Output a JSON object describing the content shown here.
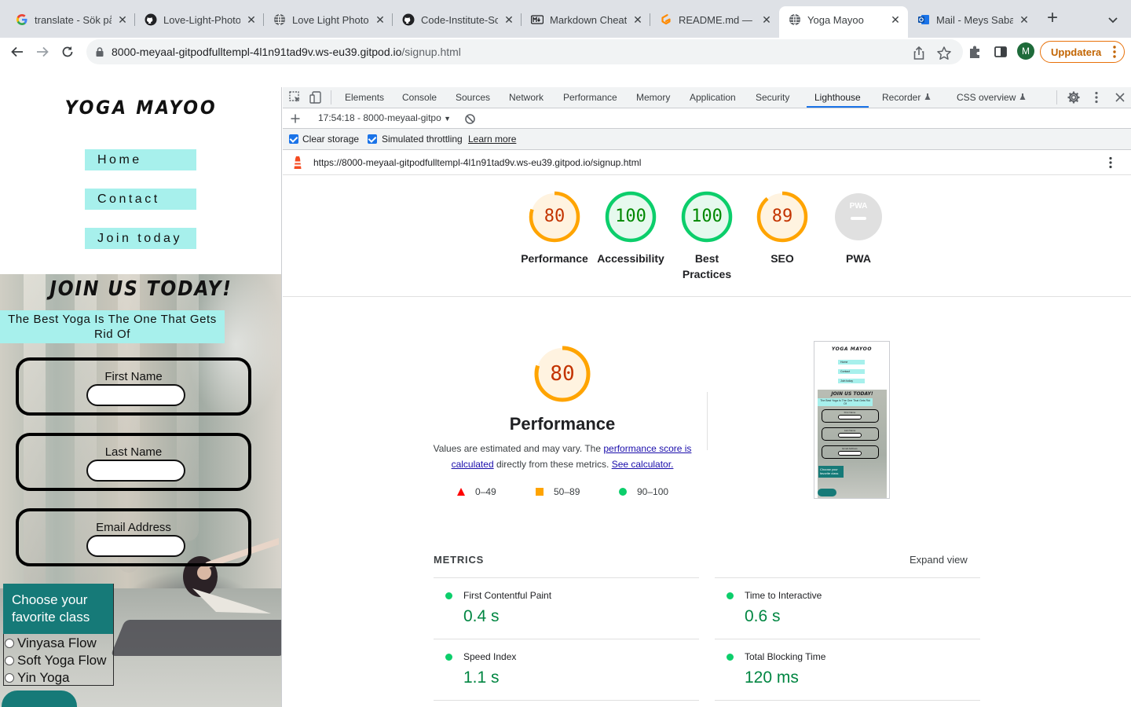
{
  "browser": {
    "tabs": [
      {
        "title": "translate - Sök på",
        "icon": "google-icon"
      },
      {
        "title": "Love-Light-Photo",
        "icon": "github-icon"
      },
      {
        "title": "Love Light Photog",
        "icon": "globe-icon"
      },
      {
        "title": "Code-Institute-So",
        "icon": "github-icon"
      },
      {
        "title": "Markdown Cheat",
        "icon": "markdown-icon"
      },
      {
        "title": "README.md — gi",
        "icon": "gitpod-icon"
      },
      {
        "title": "Yoga Mayoo",
        "icon": "globe-icon",
        "active": true
      },
      {
        "title": "Mail - Meys Saba",
        "icon": "outlook-icon"
      }
    ],
    "url_host": "8000-meyaal-gitpodfulltempl-4l1n91tad9v.ws-eu39.gitpod.io",
    "url_path": "/signup.html",
    "avatar_letter": "M",
    "update_label": "Uppdatera"
  },
  "site": {
    "logo": "YOGA MAYOO",
    "nav": [
      "Home",
      "Contact",
      "Join today"
    ],
    "join_title": "JOIN US TODAY!",
    "tagline": "The Best Yoga Is The One That Gets Rid Of",
    "fields": [
      "First Name",
      "Last Name",
      "Email Address"
    ],
    "class_heading": "Choose your favorite class",
    "classes": [
      "Vinyasa Flow",
      "Soft Yoga Flow",
      "Yin Yoga"
    ]
  },
  "devtools": {
    "tabs": [
      "Elements",
      "Console",
      "Sources",
      "Network",
      "Performance",
      "Memory",
      "Application",
      "Security",
      "Lighthouse",
      "Recorder",
      "CSS overview"
    ],
    "active_tab": "Lighthouse",
    "report_select": "17:54:18 - 8000-meyaal-gitpo",
    "clear_storage": "Clear storage",
    "simulated_throttling": "Simulated throttling",
    "learn_more": "Learn more",
    "report_url": "https://8000-meyaal-gitpodfulltempl-4l1n91tad9v.ws-eu39.gitpod.io/signup.html"
  },
  "lighthouse": {
    "scores": [
      {
        "label": "Performance",
        "value": "80",
        "score": 0.8,
        "color": "#c33300",
        "ring": "#ffa400",
        "fill": "#fff3e0"
      },
      {
        "label": "Accessibility",
        "value": "100",
        "score": 1.0,
        "color": "#008800",
        "ring": "#0cce6b",
        "fill": "#e6f9ee"
      },
      {
        "label": "Best Practices",
        "value": "100",
        "score": 1.0,
        "color": "#008800",
        "ring": "#0cce6b",
        "fill": "#e6f9ee"
      },
      {
        "label": "SEO",
        "value": "89",
        "score": 0.89,
        "color": "#c33300",
        "ring": "#ffa400",
        "fill": "#fff3e0"
      },
      {
        "label": "PWA",
        "value": "",
        "score": 0,
        "color": "#9aa0a6",
        "ring": "#e0e0e0",
        "fill": "#e0e0e0"
      }
    ],
    "pwa_badge": "PWA",
    "main_score": "80",
    "main_score_fraction": 0.8,
    "main_title": "Performance",
    "desc_prefix": "Values are estimated and may vary. The",
    "desc_link1": "performance score is calculated",
    "desc_middle": "directly from these metrics.",
    "desc_link2": "See calculator.",
    "legend": [
      "0–49",
      "50–89",
      "90–100"
    ],
    "metrics_heading": "METRICS",
    "expand_label": "Expand view",
    "metrics": [
      {
        "name": "First Contentful Paint",
        "value": "0.4 s"
      },
      {
        "name": "Time to Interactive",
        "value": "0.6 s"
      },
      {
        "name": "Speed Index",
        "value": "1.1 s"
      },
      {
        "name": "Total Blocking Time",
        "value": "120 ms"
      }
    ],
    "thumbnail": {
      "logo": "YOGA MAYOO",
      "nav": [
        "Home",
        "Contact",
        "Join today"
      ],
      "title": "JOIN US TODAY!",
      "tagline": "The Best Yoga Is The One That Gets Rid Of",
      "fields": [
        "First Name",
        "Last Name",
        "Email Address"
      ],
      "class_heading": "Choose your favorite class"
    }
  }
}
